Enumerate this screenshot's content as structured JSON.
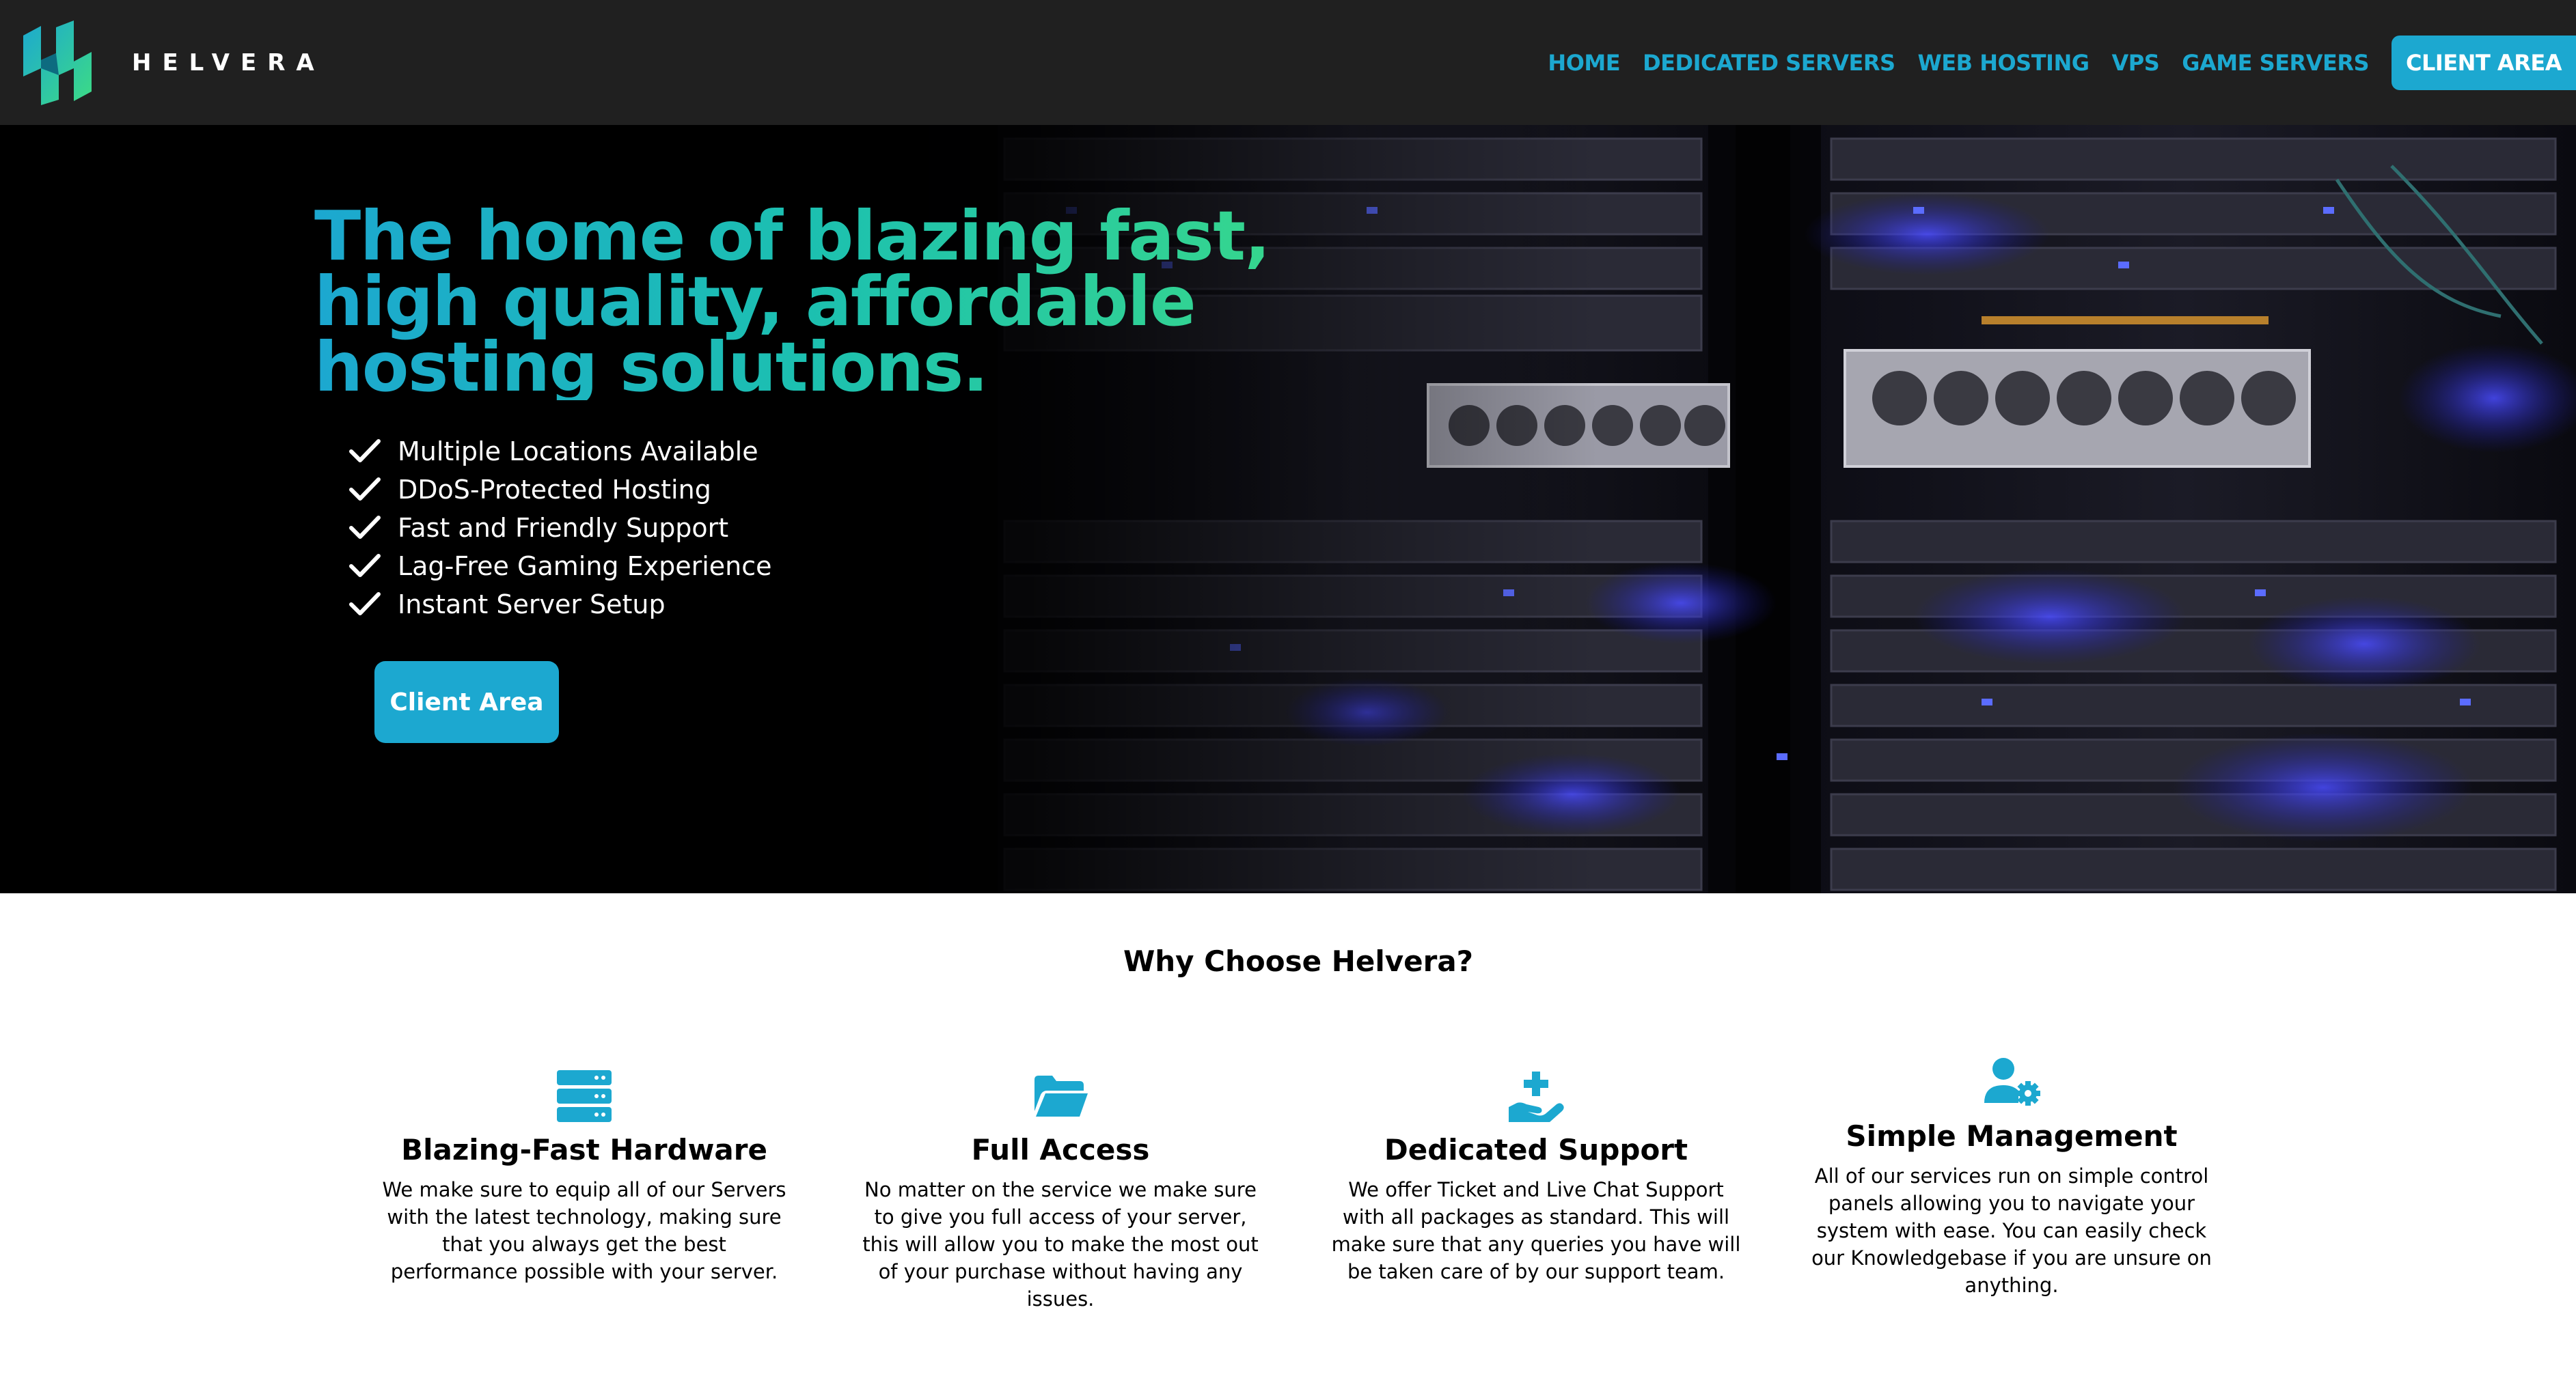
{
  "brand": {
    "name": "HELVERA",
    "logo_icon": "helvera-logo-icon"
  },
  "colors": {
    "accent": "#1ca8d0",
    "accent_green": "#3ddc84",
    "nav_bg": "#202020"
  },
  "nav": {
    "items": [
      "HOME",
      "DEDICATED SERVERS",
      "WEB HOSTING",
      "VPS",
      "GAME SERVERS"
    ],
    "cta": "CLIENT AREA"
  },
  "hero": {
    "title": "The home of blazing fast, high quality, affordable hosting solutions.",
    "features": [
      "Multiple Locations Available",
      "DDoS-Protected Hosting",
      "Fast and Friendly Support",
      "Lag-Free Gaming Experience",
      "Instant Server Setup"
    ],
    "button": "Client Area"
  },
  "why": {
    "title": "Why Choose Helvera?",
    "cards": [
      {
        "icon": "server-icon",
        "title": "Blazing-Fast Hardware",
        "text": "We make sure to equip all of our Servers with the latest technology, making sure that you always get the best performance possible with your server."
      },
      {
        "icon": "folder-open-icon",
        "title": "Full Access",
        "text": "No matter on the service we make sure to give you full access of your server, this will allow you to make the most out of your purchase without having any issues."
      },
      {
        "icon": "hand-holding-medical-icon",
        "title": "Dedicated Support",
        "text": "We offer Ticket and Live Chat Support with all packages as standard. This will make sure that any queries you have will be taken care of by our support team."
      },
      {
        "icon": "user-gear-icon",
        "title": "Simple Management",
        "text": "All of our services run on simple control panels allowing you to navigate your system with ease. You can easily check our Knowledgebase if you are unsure on anything."
      }
    ]
  }
}
